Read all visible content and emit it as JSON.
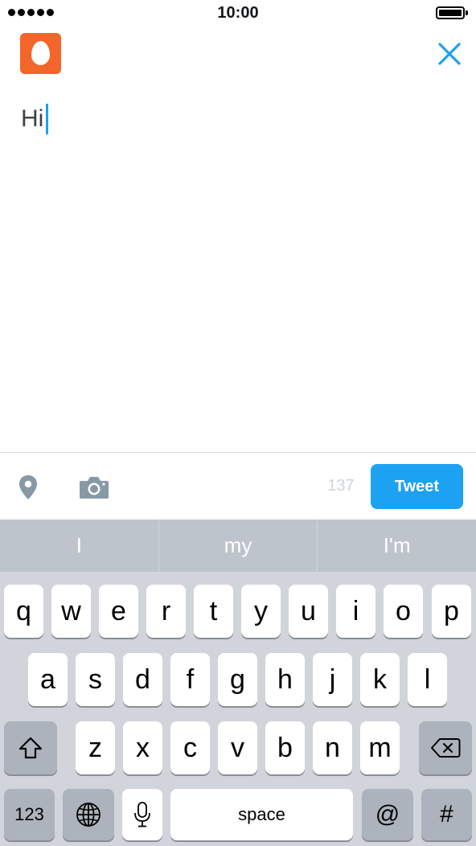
{
  "status_bar": {
    "time": "10:00"
  },
  "compose": {
    "text": "Hi"
  },
  "toolbar": {
    "char_count": "137",
    "tweet_label": "Tweet"
  },
  "suggestions": [
    "I",
    "my",
    "I'm"
  ],
  "keyboard": {
    "row1": [
      "q",
      "w",
      "e",
      "r",
      "t",
      "y",
      "u",
      "i",
      "o",
      "p"
    ],
    "row2": [
      "a",
      "s",
      "d",
      "f",
      "g",
      "h",
      "j",
      "k",
      "l"
    ],
    "row3": [
      "z",
      "x",
      "c",
      "v",
      "b",
      "n",
      "m"
    ],
    "numbers_label": "123",
    "space_label": "space",
    "at_label": "@",
    "hash_label": "#"
  },
  "colors": {
    "accent": "#1da1f2",
    "avatar": "#f4652a"
  }
}
